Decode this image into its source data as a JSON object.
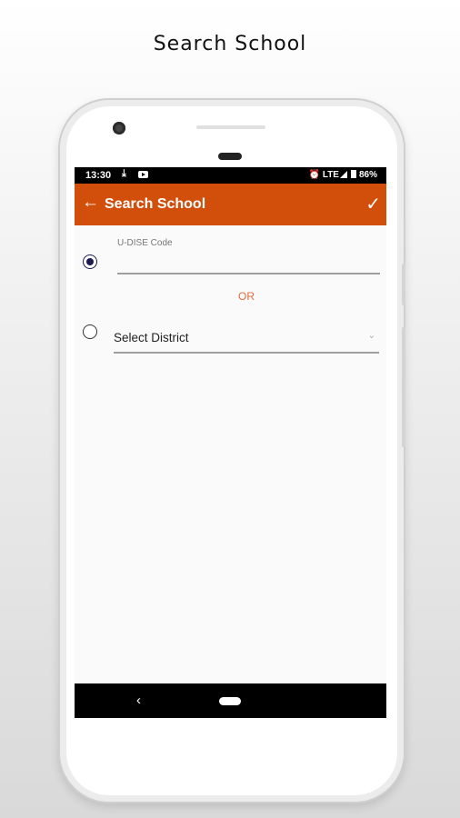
{
  "promo": {
    "title": "Search School"
  },
  "status_bar": {
    "time": "13:30",
    "network": "LTE",
    "battery": "86%"
  },
  "app_bar": {
    "title": "Search School",
    "back_icon": "arrow-left-icon",
    "confirm_icon": "check-icon"
  },
  "form": {
    "option_udise": {
      "label": "U-DISE Code",
      "value": "",
      "selected": true
    },
    "separator": "OR",
    "option_district": {
      "placeholder": "Select District",
      "selected": false
    }
  },
  "nav_bar": {
    "back_icon": "back-triangle-icon",
    "home_icon": "home-pill-icon"
  },
  "colors": {
    "accent": "#d14e0b",
    "or_text": "#e06d3a",
    "radio": "#1b1b52"
  }
}
